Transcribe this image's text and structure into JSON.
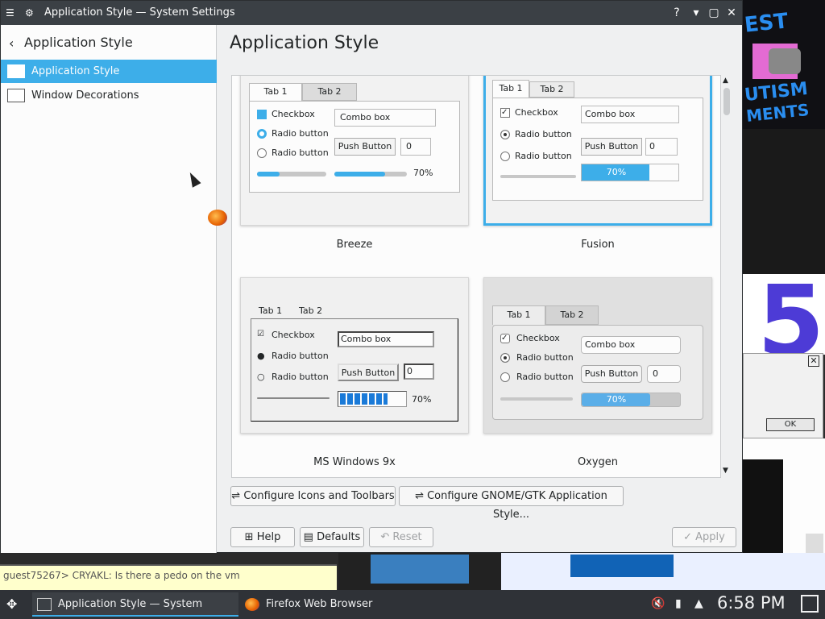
{
  "window": {
    "title": "Application Style — System Settings",
    "controls": [
      "?",
      "▾",
      "▢",
      "✕"
    ]
  },
  "sidebar": {
    "header": "Application Style",
    "items": [
      {
        "label": "Application Style",
        "selected": true
      },
      {
        "label": "Window Decorations",
        "selected": false
      }
    ]
  },
  "main": {
    "title": "Application Style",
    "styles": [
      {
        "name": "Breeze",
        "selected": false
      },
      {
        "name": "Fusion",
        "selected": true
      },
      {
        "name": "MS Windows 9x",
        "selected": false
      },
      {
        "name": "Oxygen",
        "selected": false
      }
    ],
    "preview": {
      "tab1": "Tab 1",
      "tab2": "Tab 2",
      "checkbox": "Checkbox",
      "radio": "Radio button",
      "combo": "Combo box",
      "push": "Push Button",
      "spin": "0",
      "progress": "70%",
      "progress_value": 0.7
    },
    "buttons": {
      "configure_icons": "Configure Icons and Toolbars",
      "configure_gtk": "Configure GNOME/GTK Application Style...",
      "help": "Help",
      "defaults": "Defaults",
      "reset": "Reset",
      "apply": "Apply"
    }
  },
  "chat": {
    "line": "guest75267> CRYAKL: Is there a pedo on the vm"
  },
  "background_dialog": {
    "ok": "OK"
  },
  "taskbar": {
    "tasks": [
      {
        "label": "Application Style  — System Settings",
        "active": true
      },
      {
        "label": "Firefox Web Browser",
        "active": false
      }
    ],
    "clock": "6:58 PM"
  },
  "colors": {
    "accent": "#3daee9",
    "titlebar": "#3b4045",
    "taskbar": "#2f3237"
  }
}
